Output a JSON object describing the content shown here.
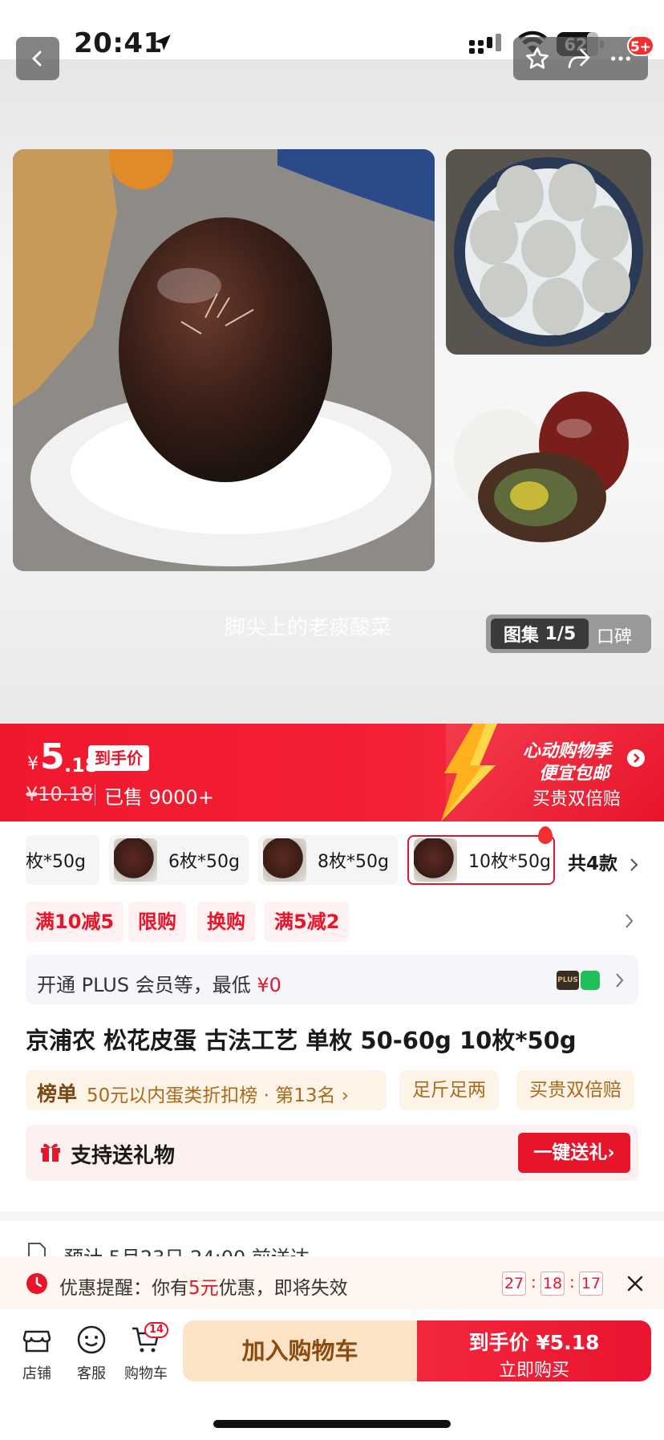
{
  "status_bar": {
    "time": "20:41",
    "battery": "62"
  },
  "header": {
    "share_badge": "5+"
  },
  "gallery": {
    "watermark": "脚尖上的老痰酸菜",
    "album_label": "图集",
    "album_index": "1/5",
    "reviews_tab": "口碑"
  },
  "price_banner": {
    "currency": "¥",
    "price_int": "5",
    "price_dec": ".18",
    "price_tag": "到手价",
    "original_price": "¥10.18",
    "sold": "已售 9000+",
    "promo_line1": "心动购物季",
    "promo_line2": "便宜包邮",
    "promo_line3": "买贵双倍赔"
  },
  "variants": [
    {
      "label": "枚*50g",
      "selected": false
    },
    {
      "label": "6枚*50g",
      "selected": false
    },
    {
      "label": "8枚*50g",
      "selected": false
    },
    {
      "label": "10枚*50g",
      "selected": true
    }
  ],
  "variant_total": "共4款",
  "promo_tags": [
    "满10减5",
    "限购",
    "换购",
    "满5减2"
  ],
  "plus": {
    "text_prefix": "开通 PLUS 会员等，最低 ",
    "price": "¥0",
    "icon_text": "PLUS"
  },
  "product_title": "京浦农 松花皮蛋 古法工艺 单枚 50-60g 10枚*50g",
  "ranking": {
    "badge": "榜单",
    "text": "50元以内蛋类折扣榜 · 第13名 ›"
  },
  "guarantee_tags": [
    "足斤足两",
    "买贵双倍赔"
  ],
  "gift": {
    "text": "支持送礼物",
    "button": "一键送礼›"
  },
  "delivery": "预计 5月23日 24:00 前送达",
  "reminder": {
    "prefix": "优惠提醒：你有",
    "amount": "5元",
    "suffix": "优惠，即将失效",
    "countdown": [
      "27",
      "18",
      "17"
    ]
  },
  "bottom_nav": [
    {
      "label": "店铺",
      "icon": "store-icon"
    },
    {
      "label": "客服",
      "icon": "service-icon"
    },
    {
      "label": "购物车",
      "icon": "cart-icon"
    }
  ],
  "cart_badge": "14",
  "buttons": {
    "add_to_cart": "加入购物车",
    "buy_line1": "到手价 ¥5.18",
    "buy_line2": "立即购买"
  }
}
